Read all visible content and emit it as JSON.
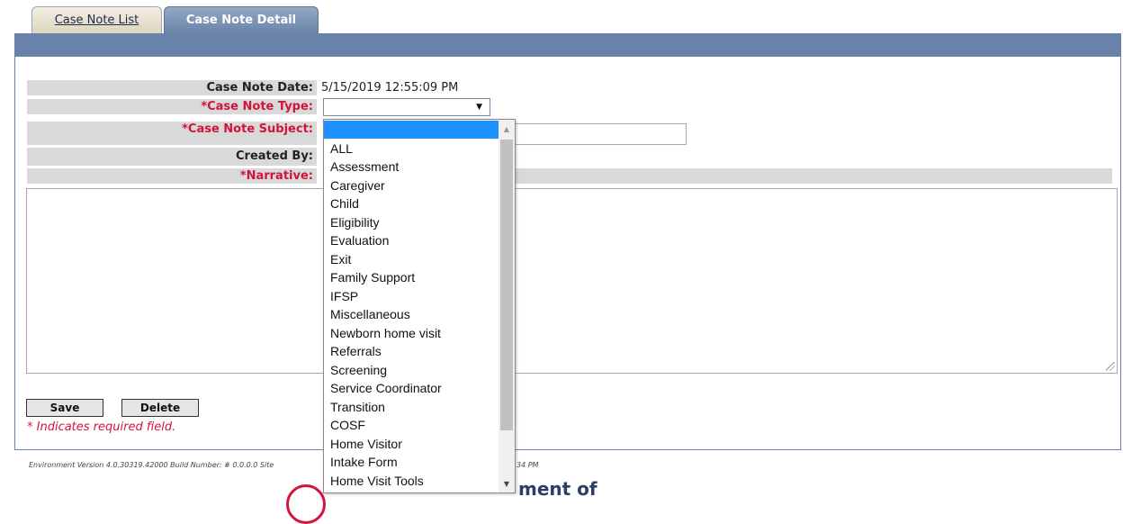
{
  "tabs": [
    {
      "label": "Case Note List",
      "active": false
    },
    {
      "label": "Case Note Detail",
      "active": true
    }
  ],
  "form": {
    "date_label": "Case Note Date:",
    "date_value": "5/15/2019 12:55:09 PM",
    "type_label": "*Case Note Type:",
    "type_value": "",
    "subject_label": "*Case Note Subject:",
    "subject_value": "",
    "created_by_label": "Created By:",
    "narrative_label": "*Narrative:",
    "narrative_value": ""
  },
  "buttons": {
    "save": "Save",
    "delete": "Delete"
  },
  "required_note": "* Indicates required field.",
  "footer": {
    "version_text": "Environment Version 4.0.30319.42000 Build Number: # 0.0.0.0 Site",
    "time_fragment": "34 PM",
    "department_fragment": "ment of"
  },
  "dropdown": {
    "options": [
      "",
      "ALL",
      "Assessment",
      "Caregiver",
      "Child",
      "Eligibility",
      "Evaluation",
      "Exit",
      "Family Support",
      "IFSP",
      "Miscellaneous",
      "Newborn home visit",
      "Referrals",
      "Screening",
      "Service Coordinator",
      "Transition",
      "COSF",
      "Home Visitor",
      "Intake Form",
      "Home Visit Tools"
    ],
    "selected_index": 0
  },
  "colors": {
    "header_bar": "#6982aa",
    "required_text": "#d2143c",
    "label_background": "#d9d9d9",
    "selected_option": "#1e90ff"
  },
  "icons": {
    "select_arrow": "chevron-down-icon",
    "scroll_up": "scroll-up-icon",
    "scroll_down": "scroll-down-icon"
  }
}
